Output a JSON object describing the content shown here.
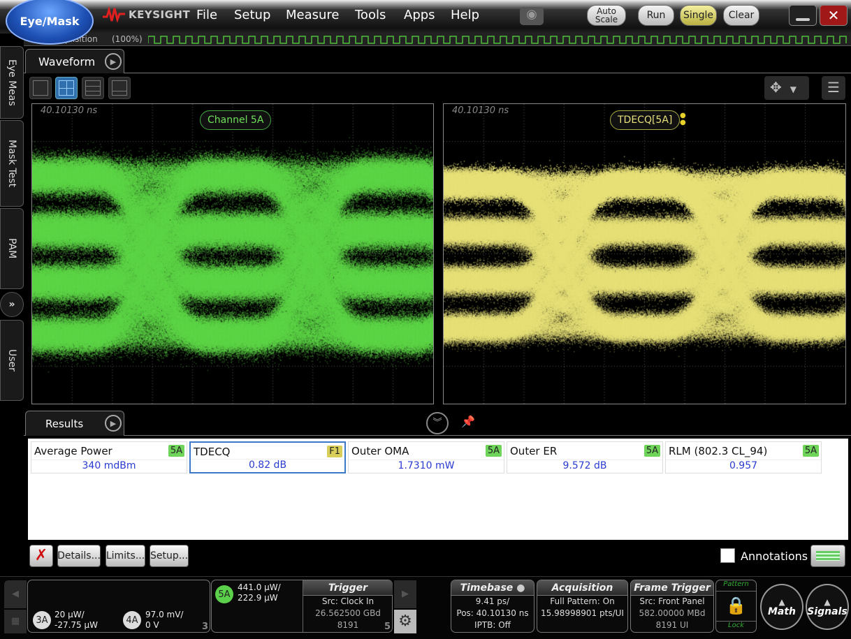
{
  "app": {
    "mode_button": "Eye/Mask",
    "brand": "KEYSIGHT"
  },
  "menu": [
    "File",
    "Setup",
    "Measure",
    "Tools",
    "Apps",
    "Help"
  ],
  "toolbar": {
    "auto_scale": "Auto Scale",
    "run": "Run",
    "single": "Single",
    "clear": "Clear"
  },
  "acquisition_strip": {
    "label": "Acquisition",
    "progress": "(100%)",
    "progress_percent": 100
  },
  "sidebar": [
    "Eye Meas",
    "Mask Test",
    "PAM",
    "User"
  ],
  "waveform": {
    "tab": "Waveform",
    "plots": [
      {
        "timestamp": "40.10130 ns",
        "label": "Channel 5A",
        "color": "#6fe05a"
      },
      {
        "timestamp": "40.10130 ns",
        "label": "TDECQ[5A]",
        "color": "#e6e07a"
      }
    ]
  },
  "results": {
    "tab": "Results",
    "measurements": [
      {
        "name": "Average Power",
        "badge": "5A",
        "value": "340 mdBm",
        "badge_color": "#6fd45a"
      },
      {
        "name": "TDECQ",
        "badge": "F1",
        "value": "0.82 dB",
        "badge_color": "#d8cf5a",
        "selected": true
      },
      {
        "name": "Outer OMA",
        "badge": "5A",
        "value": "1.7310 mW",
        "badge_color": "#6fd45a"
      },
      {
        "name": "Outer ER",
        "badge": "5A",
        "value": "9.572 dB",
        "badge_color": "#6fd45a"
      },
      {
        "name": "RLM (802.3 CL_94)",
        "badge": "5A",
        "value": "0.957",
        "badge_color": "#6fd45a"
      }
    ],
    "buttons": {
      "details": "Details...",
      "limits": "Limits...",
      "setup": "Setup..."
    },
    "annotations": {
      "label": "Annotations",
      "checked": false
    }
  },
  "status": {
    "ch3": {
      "chip": "3A",
      "l1": "20 µW/",
      "l2": "-27.75 µW"
    },
    "ch4": {
      "chip": "4A",
      "l1": "97.0 mV/",
      "l2": "0 V"
    },
    "group1_num": "3",
    "ch5": {
      "chip": "5A",
      "l1": "441.0 µW/",
      "l2": "222.9 µW"
    },
    "trigger": {
      "title": "Trigger",
      "l1": "Src: Clock In",
      "l2": "26.562500 GBd",
      "l3": "8191"
    },
    "group2_num": "5",
    "timebase": {
      "title": "Timebase",
      "l1": "9.41 ps/",
      "l2": "Pos: 40.10130 ns",
      "l3": "IPTB: Off"
    },
    "acquisition": {
      "title": "Acquisition",
      "l1": "Full Pattern: On",
      "l2": "15.98998901 pts/UI"
    },
    "frame_trigger": {
      "title": "Frame Trigger",
      "l1": "Src: Front Panel",
      "l2": "582.00000 MBd",
      "l3": "8191 UI"
    },
    "pattern_lock": {
      "top": "Pattern",
      "bottom": "Lock"
    },
    "math": "Math",
    "signals": "Signals"
  }
}
